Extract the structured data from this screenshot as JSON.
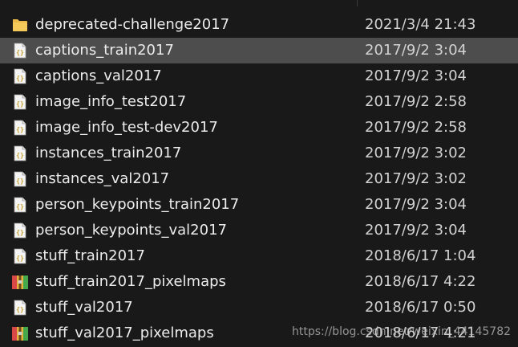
{
  "files": [
    {
      "name": "deprecated-challenge2017",
      "date": "2021/3/4 21:43",
      "type": "folder",
      "icon": "folder-icon",
      "selected": false
    },
    {
      "name": "captions_train2017",
      "date": "2017/9/2 3:04",
      "type": "json",
      "icon": "json-file-icon",
      "selected": true
    },
    {
      "name": "captions_val2017",
      "date": "2017/9/2 3:04",
      "type": "json",
      "icon": "json-file-icon",
      "selected": false
    },
    {
      "name": "image_info_test2017",
      "date": "2017/9/2 2:58",
      "type": "json",
      "icon": "json-file-icon",
      "selected": false
    },
    {
      "name": "image_info_test-dev2017",
      "date": "2017/9/2 2:58",
      "type": "json",
      "icon": "json-file-icon",
      "selected": false
    },
    {
      "name": "instances_train2017",
      "date": "2017/9/2 3:02",
      "type": "json",
      "icon": "json-file-icon",
      "selected": false
    },
    {
      "name": "instances_val2017",
      "date": "2017/9/2 3:02",
      "type": "json",
      "icon": "json-file-icon",
      "selected": false
    },
    {
      "name": "person_keypoints_train2017",
      "date": "2017/9/2 3:04",
      "type": "json",
      "icon": "json-file-icon",
      "selected": false
    },
    {
      "name": "person_keypoints_val2017",
      "date": "2017/9/2 3:04",
      "type": "json",
      "icon": "json-file-icon",
      "selected": false
    },
    {
      "name": "stuff_train2017",
      "date": "2018/6/17 1:04",
      "type": "json",
      "icon": "json-file-icon",
      "selected": false
    },
    {
      "name": "stuff_train2017_pixelmaps",
      "date": "2018/6/17 4:22",
      "type": "archive",
      "icon": "zip-archive-icon",
      "selected": false
    },
    {
      "name": "stuff_val2017",
      "date": "2018/6/17 0:50",
      "type": "json",
      "icon": "json-file-icon",
      "selected": false
    },
    {
      "name": "stuff_val2017_pixelmaps",
      "date": "2018/6/17 4:21",
      "type": "archive",
      "icon": "zip-archive-icon",
      "selected": false
    }
  ],
  "watermark": "https://blog.csdn.net/weixin_44145782",
  "colors": {
    "background": "#191919",
    "selected_row": "#4d4d4d",
    "text": "#ececec",
    "folder": "#e8b849",
    "json_brace": "#c8a028"
  }
}
